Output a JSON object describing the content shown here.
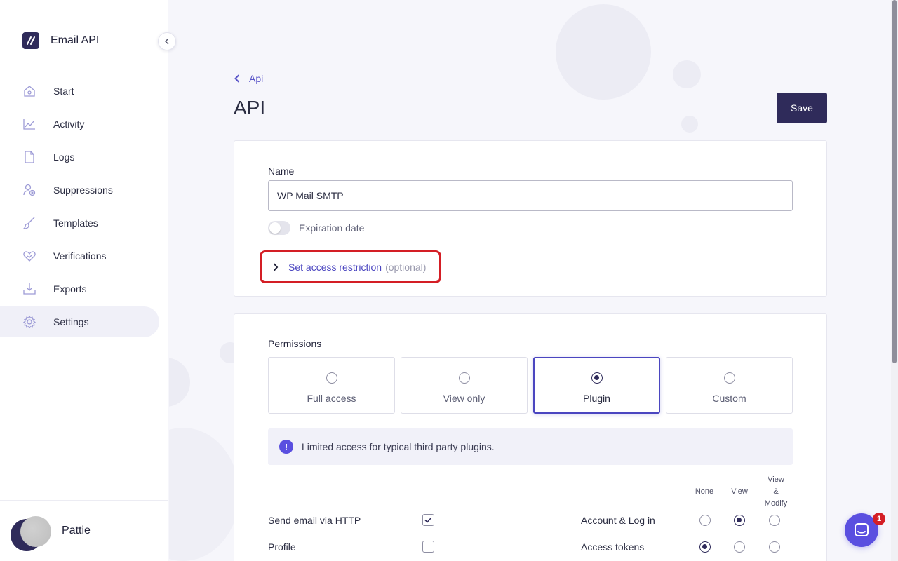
{
  "app": {
    "name": "Email API"
  },
  "sidebar": {
    "items": [
      {
        "label": "Start",
        "icon": "home-icon"
      },
      {
        "label": "Activity",
        "icon": "chart-icon"
      },
      {
        "label": "Logs",
        "icon": "file-icon"
      },
      {
        "label": "Suppressions",
        "icon": "user-block-icon"
      },
      {
        "label": "Templates",
        "icon": "brush-icon"
      },
      {
        "label": "Verifications",
        "icon": "heart-icon"
      },
      {
        "label": "Exports",
        "icon": "download-icon"
      },
      {
        "label": "Settings",
        "icon": "gear-icon",
        "active": true
      }
    ],
    "user": {
      "name": "Pattie"
    }
  },
  "header": {
    "breadcrumb": "Api",
    "title": "API",
    "save_label": "Save"
  },
  "form": {
    "name_label": "Name",
    "name_value": "WP Mail SMTP",
    "expiration_label": "Expiration date",
    "expiration_enabled": false,
    "restriction_label": "Set access restriction",
    "restriction_optional": "(optional)"
  },
  "permissions": {
    "label": "Permissions",
    "options": [
      "Full access",
      "View only",
      "Plugin",
      "Custom"
    ],
    "selected": "Plugin",
    "info": "Limited access for typical third party plugins.",
    "columns": [
      "None",
      "View",
      "View & Modify"
    ],
    "left_rows": [
      {
        "label": "Send email via HTTP",
        "checked": true
      },
      {
        "label": "Profile",
        "checked": false
      }
    ],
    "right_rows": [
      {
        "label": "Account & Log in",
        "selected": "View"
      },
      {
        "label": "Access tokens",
        "selected": "None"
      }
    ]
  },
  "chat": {
    "badge": "1"
  },
  "colors": {
    "accent": "#4b46c0",
    "brand": "#2f2b5a",
    "highlight": "#d41e25"
  }
}
